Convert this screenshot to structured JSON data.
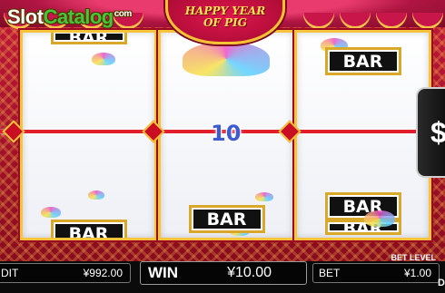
{
  "brand": {
    "slot": "Slot",
    "catalog": "Catalog",
    "com": "com"
  },
  "game_title": {
    "line1": "HAPPY YEAR",
    "line2": "OF PIG"
  },
  "reels": {
    "reel1": {
      "top_symbol": "BAR",
      "bottom_symbol": "BAR"
    },
    "reel2": {
      "bottom_symbol": "BAR"
    },
    "reel3": {
      "top_symbol": "BAR",
      "bottom_symbol_1": "BAR",
      "bottom_symbol_2": "BAR"
    }
  },
  "payline_win": "10",
  "spin_button": {
    "symbol": "$"
  },
  "bottom_bar": {
    "credit_label": "DIT",
    "credit_value": "¥992.00",
    "win_label": "WIN",
    "win_value": "¥10.00",
    "bet_label": "BET",
    "bet_value": "¥1.00",
    "bet_level_label": "BET LEVEL",
    "corner_letter": "D"
  },
  "colors": {
    "frame_red": "#c2183a",
    "gold_border": "#f6c33a",
    "payline": "#e21e2c",
    "win_number": "#3f5bd0",
    "logo_green": "#44c73a"
  }
}
